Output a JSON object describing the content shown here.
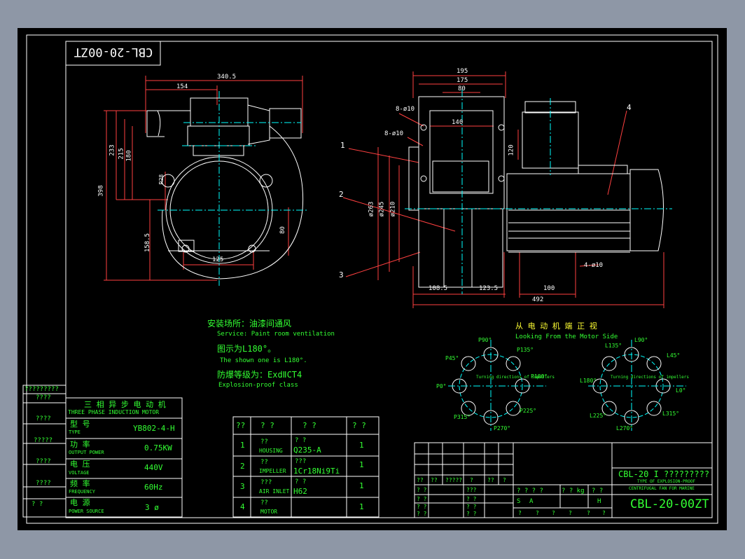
{
  "drawing_number": "CBL-20-00ZT",
  "drawing_number_mirrored": "CBL-20-00ZT",
  "dimensions": {
    "front": [
      "340.5",
      "154",
      "233",
      "215",
      "180",
      "398",
      "158.5",
      "125",
      "80",
      "R28"
    ],
    "side": [
      "195",
      "175",
      "80",
      "140",
      "120",
      "8-ø10",
      "8-ø10",
      "ø263",
      "ø245",
      "ø210",
      "108.5",
      "123.5",
      "100",
      "492",
      "4-ø10"
    ]
  },
  "part_callouts": [
    "1",
    "2",
    "3",
    "4"
  ],
  "notes": {
    "install_cn": "安装场所：油漆间通风",
    "install_en": "Service: Paint room ventilation",
    "shown_cn": "图示为L180°。",
    "shown_en": "The shown one is L180°.",
    "protect_cn": "防爆等级为：ExdⅡCT4",
    "protect_en": "Explosion-proof class"
  },
  "view_title": {
    "cn": "从 电 动 机 端 正 视",
    "en": "Looking From the Motor Side"
  },
  "left_rosette": {
    "labels": [
      "P90°",
      "P45°",
      "P135°",
      "P0°",
      "P180°",
      "P315°",
      "P225°",
      "P270°"
    ],
    "note": "Turning directions of impellers"
  },
  "right_rosette": {
    "labels": [
      "L90°",
      "L135°",
      "L45°",
      "L180°",
      "L0°",
      "L225°",
      "L315°",
      "L270°"
    ],
    "note": "Turning directions of impellers"
  },
  "motor_table": {
    "side_labels": [
      "?????????",
      "????",
      "????",
      "?????",
      "????",
      "????",
      "?  ?"
    ],
    "title_cn": "三 相 异 步 电 动 机",
    "title_en": "THREE PHASE INDUCTION MOTOR",
    "rows": [
      {
        "cn": "型  号",
        "en": "TYPE",
        "value": "YB802-4-H"
      },
      {
        "cn": "功  率",
        "en": "OUTPUT POWER",
        "value": "0.75KW"
      },
      {
        "cn": "电  压",
        "en": "VOLTAGE",
        "value": "440V"
      },
      {
        "cn": "频  率",
        "en": "FREQUENCY",
        "value": "60Hz"
      },
      {
        "cn": "电  源",
        "en": "POWER SOURCE",
        "value": "3 ø"
      }
    ]
  },
  "parts_table": {
    "headers": [
      "??",
      "? ?",
      "?   ?",
      "? ?"
    ],
    "rows": [
      {
        "no": "1",
        "name_q": "??",
        "name": "HOUSING",
        "material": "Q235-A",
        "mat_q": "? ?",
        "qty": "1"
      },
      {
        "no": "2",
        "name_q": "??",
        "name": "IMPELLER",
        "material": "1Cr18Ni9Ti",
        "mat_q": "???",
        "qty": "1"
      },
      {
        "no": "3",
        "name_q": "???",
        "name": "AIR INLET",
        "material": "H62",
        "mat_q": "? ?",
        "qty": "1"
      },
      {
        "no": "4",
        "name_q": "??",
        "name": "MOTOR",
        "material": "",
        "mat_q": "",
        "qty": "1"
      }
    ]
  },
  "title_block": {
    "name_line": "CBL-20 I ?????????",
    "en_line1": "TYPE OF EXPLOSION-PROOF",
    "en_line2": "CENTRIFUGAL FAN FOR MARINE",
    "number": "CBL-20-00ZT",
    "rev_headers": [
      "??",
      "??",
      "?????",
      "?",
      "??",
      "?"
    ],
    "rows_left": [
      "?  ?",
      "?  ?",
      "?  ?",
      "?  ?"
    ],
    "rows_mid": [
      "???",
      "? ?",
      "? ?",
      "? ?"
    ],
    "mass_headers": [
      "? ? ? ?",
      "? ? kg",
      "? ?"
    ],
    "stage": [
      "S",
      "A",
      "",
      "",
      "",
      "H"
    ],
    "sheet": [
      "?",
      "?",
      "?",
      "?",
      "?",
      "?"
    ]
  },
  "colors": {
    "background": "#8e97a6",
    "sheet": "#000000",
    "border": "#ffffff",
    "outline": "#ffffff",
    "dimension": "#ff4040",
    "centerline": "#00ffff",
    "text": "#33ff33",
    "note": "#ffff33"
  }
}
